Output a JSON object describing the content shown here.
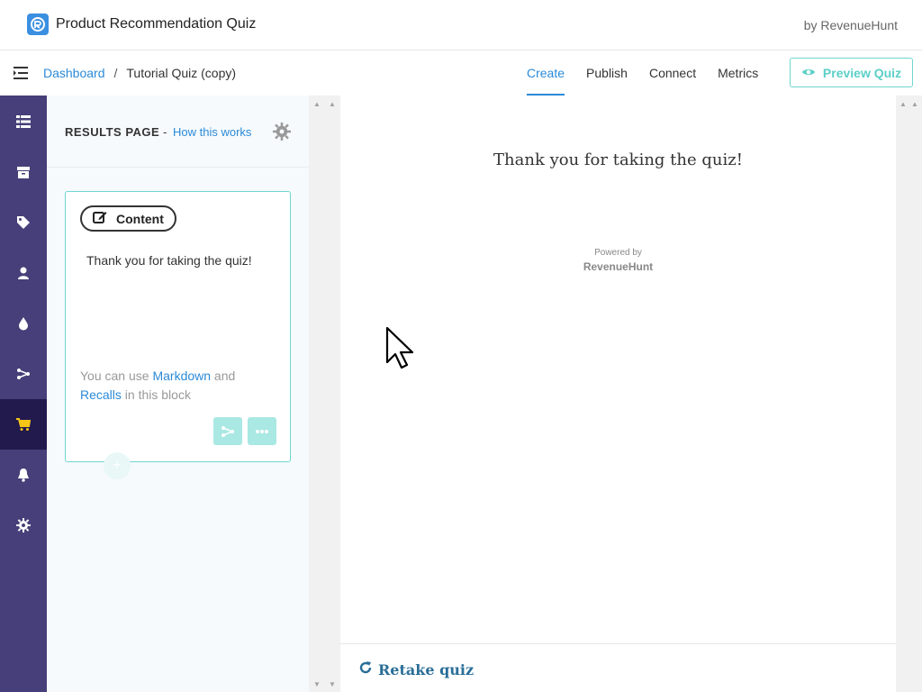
{
  "app": {
    "title": "Product Recommendation Quiz",
    "by": "by RevenueHunt",
    "logo_icon": "revenuehunt-logo-icon"
  },
  "breadcrumb": {
    "root": "Dashboard",
    "separator": "/",
    "current": "Tutorial Quiz (copy)"
  },
  "tabs": [
    {
      "label": "Create",
      "active": true
    },
    {
      "label": "Publish",
      "active": false
    },
    {
      "label": "Connect",
      "active": false
    },
    {
      "label": "Metrics",
      "active": false
    }
  ],
  "preview_button": {
    "label": "Preview Quiz",
    "icon": "eye-icon"
  },
  "sidebar": {
    "items": [
      {
        "icon": "list-icon",
        "active": false
      },
      {
        "icon": "box-icon",
        "active": false
      },
      {
        "icon": "tag-icon",
        "active": false
      },
      {
        "icon": "user-icon",
        "active": false
      },
      {
        "icon": "drop-icon",
        "active": false
      },
      {
        "icon": "flow-icon",
        "active": false
      },
      {
        "icon": "cart-icon",
        "active": true
      },
      {
        "icon": "bell-icon",
        "active": false
      },
      {
        "icon": "gear-icon",
        "active": false
      }
    ]
  },
  "panel": {
    "title": "RESULTS PAGE",
    "dash": "-",
    "help_link": "How this works",
    "card": {
      "pill_label": "Content",
      "text": "Thank you for taking the quiz!",
      "help_pre": "You can use ",
      "help_link1": "Markdown",
      "help_mid": " and",
      "help_link2": "Recalls",
      "help_post": " in this block"
    }
  },
  "preview": {
    "heading": "Thank you for taking the quiz!",
    "powered_by": "Powered by",
    "brand": "RevenueHunt",
    "retake_label": "Retake quiz"
  },
  "colors": {
    "accent_blue": "#2b8ad8",
    "teal": "#6fd6cf",
    "sidebar_bg": "#463f79",
    "sidebar_active": "#221a4d",
    "cart_yellow": "#f5c518"
  }
}
